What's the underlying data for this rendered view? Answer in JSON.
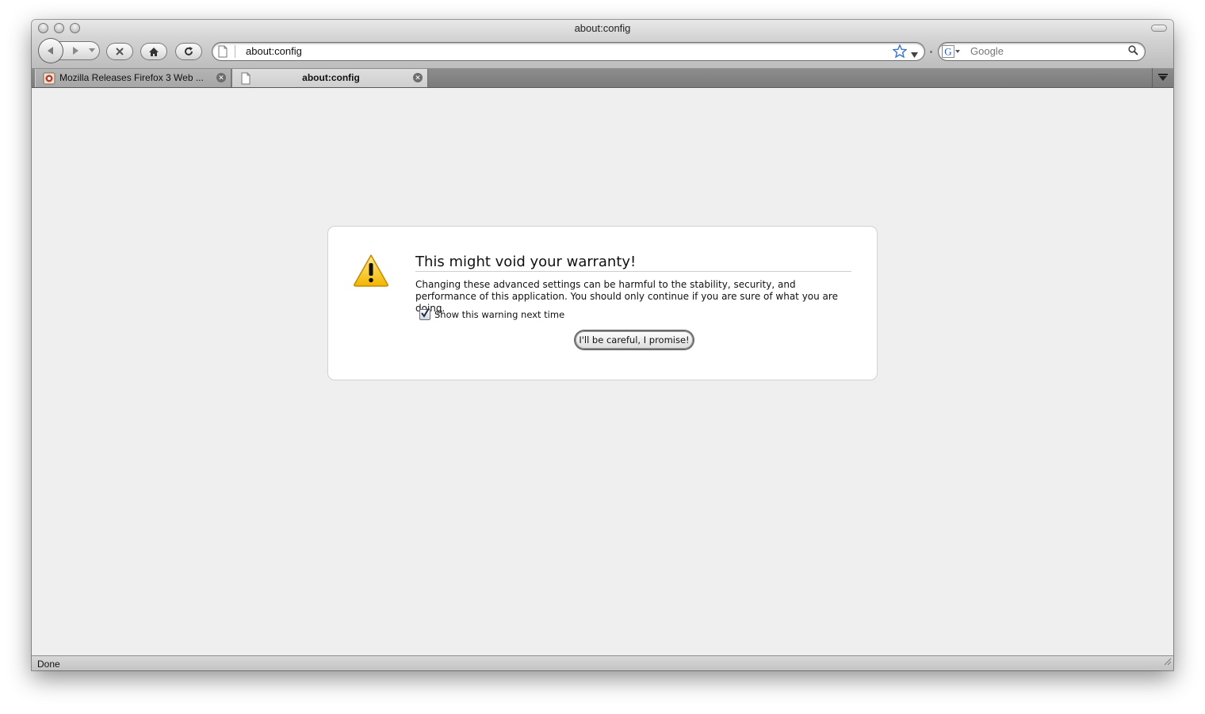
{
  "window": {
    "title": "about:config"
  },
  "toolbar": {
    "url": "about:config",
    "search_placeholder": "Google",
    "search_engine_letter": "G"
  },
  "tabs": [
    {
      "label": "Mozilla Releases Firefox 3 Web ...",
      "active": false
    },
    {
      "label": "about:config",
      "active": true
    }
  ],
  "warning": {
    "title": "This might void your warranty!",
    "body": "Changing these advanced settings can be harmful to the stability, security, and performance of this application. You should only continue if you are sure of what you are doing.",
    "checkbox_label": "Show this warning next time",
    "checkbox_checked": true,
    "button_label": "I'll be careful, I promise!"
  },
  "status": {
    "text": "Done"
  },
  "icons": {
    "back": "back-arrow-icon",
    "forward": "forward-arrow-icon",
    "stop": "stop-icon",
    "home": "home-icon",
    "reload": "reload-icon",
    "page": "page-icon",
    "bookmark": "star-icon",
    "search": "magnifier-icon",
    "warning": "warning-triangle-icon",
    "tab_list": "tab-list-icon"
  }
}
